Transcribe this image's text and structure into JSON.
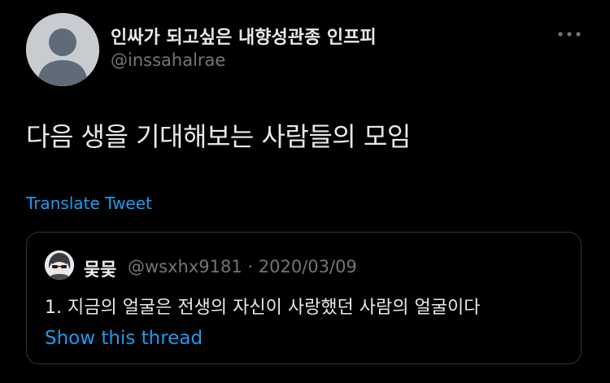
{
  "author": {
    "display_name": "인싸가 되고싶은 내향성관종 인프피",
    "handle": "@inssahalrae",
    "avatar_icon": "default-profile-icon"
  },
  "tweet": {
    "text": "다음 생을 기대해보는 사람들의 모임",
    "translate_label": "Translate Tweet",
    "more_icon": "more-horizontal-icon"
  },
  "quoted_tweet": {
    "display_name": "뭊뭊",
    "meta": "@wsxhx9181 · 2020/03/09",
    "text": "1. 지금의 얼굴은 전생의 자신이 사랑했던 사람의 얼굴이다",
    "thread_link": "Show this thread",
    "avatar_icon": "anime-avatar-icon"
  },
  "colors": {
    "background": "#000000",
    "primary_text": "#e7e9ea",
    "secondary_text": "#71767b",
    "link": "#1d9bf0",
    "border": "#2f3336"
  }
}
